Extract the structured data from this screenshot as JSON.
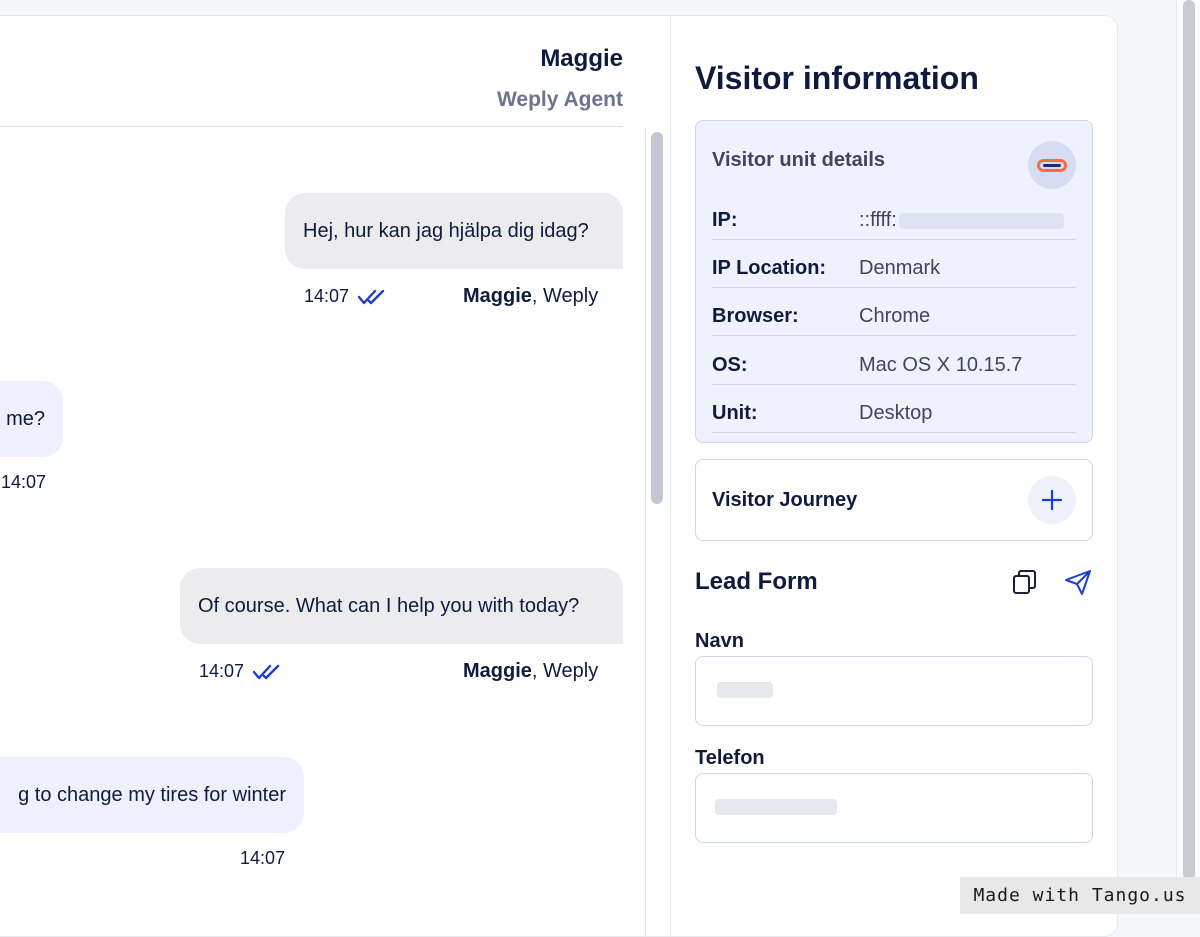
{
  "chat": {
    "agent_name": "Maggie",
    "agent_role": "Weply Agent",
    "messages": [
      {
        "text": "Hej, hur kan jag hjälpa dig idag?",
        "time": "14:07",
        "sender_name": "Maggie",
        "sender_company": ", Weply",
        "status": "double-check-icon"
      },
      {
        "text": "me?",
        "time": "14:07"
      },
      {
        "text": "Of course. What can I help you with today?",
        "time": "14:07",
        "sender_name": "Maggie",
        "sender_company": ", Weply",
        "status": "double-check-icon"
      },
      {
        "text": "g to change my tires for winter",
        "time": "14:07"
      }
    ]
  },
  "visitor": {
    "title": "Visitor information",
    "details": {
      "title": "Visitor unit details",
      "rows": [
        {
          "label": "IP:",
          "value": "::ffff:"
        },
        {
          "label": "IP Location:",
          "value": "Denmark"
        },
        {
          "label": "Browser:",
          "value": "Chrome"
        },
        {
          "label": "OS:",
          "value": "Mac OS X 10.15.7"
        },
        {
          "label": "Unit:",
          "value": "Desktop"
        }
      ]
    },
    "journey": {
      "title": "Visitor Journey"
    },
    "lead_form": {
      "title": "Lead Form",
      "fields": [
        {
          "label": "Navn",
          "value": ""
        },
        {
          "label": "Telefon",
          "value": ""
        }
      ]
    }
  },
  "colors": {
    "accent": "#1d3ccf",
    "highlight": "#ff6a3d",
    "bubble_out": "#ececee",
    "bubble_in": "#eef1fd"
  },
  "watermark": "Made with Tango.us"
}
